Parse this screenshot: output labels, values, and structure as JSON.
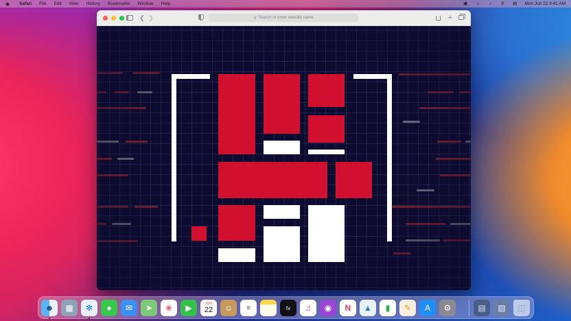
{
  "menubar": {
    "apple": "",
    "items": [
      "Safari",
      "File",
      "Edit",
      "View",
      "History",
      "Bookmarks",
      "Window",
      "Help"
    ],
    "clock": "Mon Jun 22  9:41 AM"
  },
  "window": {
    "address_placeholder": "Search or enter website name"
  },
  "dock": {
    "calendar_month": "JUN",
    "calendar_day": "22",
    "apps": [
      "finder",
      "launchpad",
      "safari",
      "messages",
      "mail",
      "maps",
      "photos",
      "facetime",
      "calendar",
      "contacts",
      "reminders",
      "notes",
      "tv",
      "music",
      "podcasts",
      "news",
      "keynote",
      "numbers",
      "pages",
      "app-store",
      "system-preferences",
      "downloads-stack",
      "documents-stack",
      "trash"
    ],
    "tv_label": "tv"
  },
  "colors": {
    "accent_red": "#d0102e",
    "content_bg": "#0d0b30"
  }
}
